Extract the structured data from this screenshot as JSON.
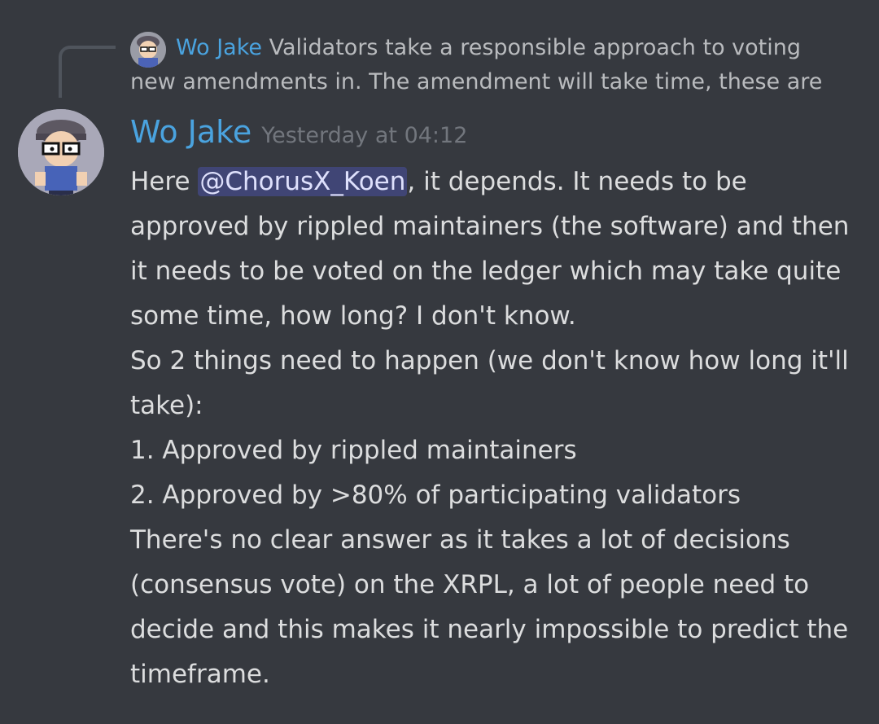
{
  "reply": {
    "author": "Wo Jake",
    "text": "Validators take a responsible approach to voting new amendments in. The amendment will take time, these are"
  },
  "message": {
    "author": "Wo Jake",
    "timestamp": "Yesterday at 04:12",
    "intro_before": "Here ",
    "mention": "@ChorusX_Koen",
    "intro_after": ", it depends. It needs to be approved by rippled maintainers (the software) and then it needs to be voted on the ledger which may take quite some time, how long? I don't know.",
    "line2": "So 2 things need to happen (we don't know how long it'll take):",
    "line3": "1. Approved by rippled maintainers",
    "line4": "2. Approved by >80% of participating validators",
    "line5": "There's no clear answer as it takes a lot of decisions (consensus vote) on the XRPL, a lot of people need to decide and this makes it nearly impossible to predict the timeframe."
  },
  "colors": {
    "background": "#36393f",
    "author": "#4aa3df",
    "mention_bg": "#4a4f8c",
    "text": "#dcddde",
    "muted": "#72767d"
  },
  "icons": {
    "reply_avatar": "south-park-avatar-icon",
    "avatar": "south-park-avatar-icon"
  }
}
